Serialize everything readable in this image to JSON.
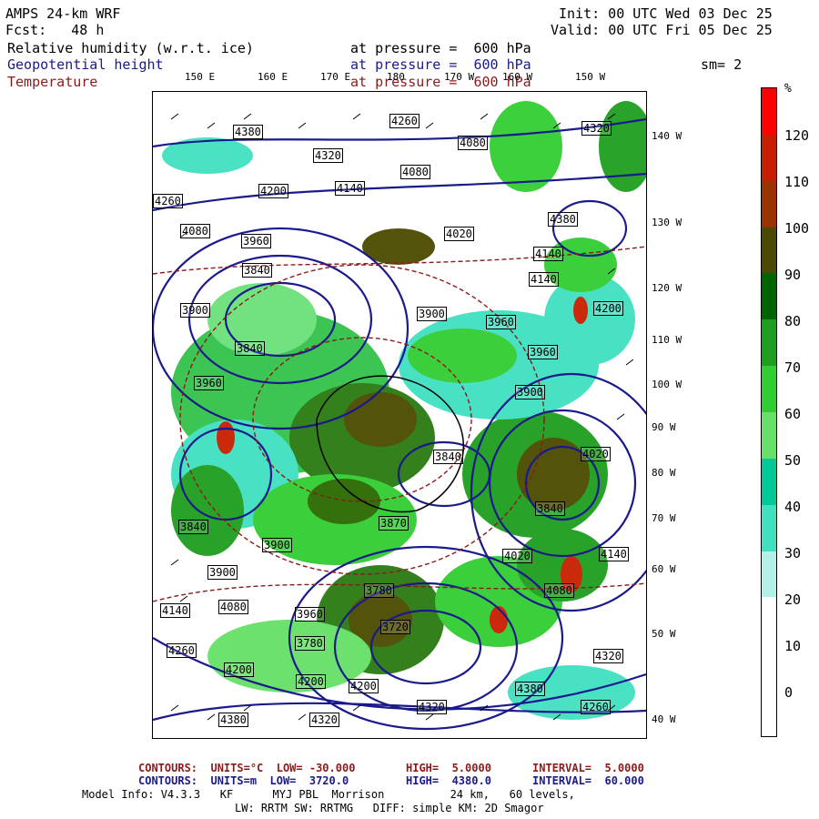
{
  "header": {
    "title": "AMPS 24-km WRF",
    "fcst": "Fcst:   48 h",
    "init": "Init: 00 UTC Wed 03 Dec 25",
    "valid": "Valid: 00 UTC Fri 05 Dec 25",
    "field1": "Relative humidity (w.r.t. ice)",
    "field2": "Geopotential height",
    "field3": "Temperature",
    "level1": "at pressure =  600 hPa",
    "level2": "at pressure =  600 hPa",
    "level3": "at pressure =  600 hPa",
    "sm": "sm= 2"
  },
  "colors": {
    "blue_text": "#1a1a8c",
    "maroon_text": "#8b1a1a",
    "height_contour": "#1a1a8c",
    "temp_contour": "#8b1a1a"
  },
  "longitude_labels": [
    "150 E",
    "160 E",
    "170 E",
    "180",
    "170 W",
    "160 W",
    "150 W"
  ],
  "latitude_labels": [
    "140 W",
    "130 W",
    "120 W",
    "110 W",
    "100 W",
    "90 W",
    "80 W",
    "70 W",
    "60 W",
    "50 W",
    "40 W"
  ],
  "height_labels": [
    "4380",
    "4320",
    "4200",
    "4140",
    "4260",
    "4080",
    "4080",
    "4380",
    "4320",
    "4140",
    "4020",
    "3960",
    "4260",
    "4080",
    "4140",
    "4200",
    "3840",
    "3900",
    "3900",
    "3960",
    "3840",
    "3900",
    "3960",
    "3960",
    "4020",
    "3840",
    "3900",
    "3870",
    "3840",
    "3840",
    "3900",
    "3960",
    "4020",
    "4080",
    "4140",
    "3780",
    "3720",
    "3780",
    "4080",
    "4140",
    "4200",
    "4320",
    "4380",
    "4320",
    "4260",
    "4200",
    "4200",
    "4320",
    "4260",
    "4380"
  ],
  "colorbar": {
    "unit": "%",
    "labels": [
      "120",
      "110",
      "100",
      "90",
      "80",
      "70",
      "60",
      "50",
      "40",
      "30",
      "20",
      "10",
      "0"
    ],
    "colors": [
      "#ff0000",
      "#c81e00",
      "#993300",
      "#4a4a00",
      "#006400",
      "#1e9e1e",
      "#32cd32",
      "#66e066",
      "#00c896",
      "#40e0c0",
      "#b4f0e6",
      "#ffffff",
      "#ffffff",
      "#ffffff"
    ]
  },
  "footer": {
    "line1_a": "CONTOURS:  UNITS=°C  LOW= -30.000",
    "line1_b": "HIGH=  5.0000",
    "line1_c": "INTERVAL=  5.0000",
    "line2_a": "CONTOURS:  UNITS=m  LOW=  3720.0",
    "line2_b": "HIGH=  4380.0",
    "line2_c": "INTERVAL=  60.000",
    "line3": "Model Info: V4.3.3   KF      MYJ PBL  Morrison          24 km,   60 levels,",
    "line4": "LW: RRTM SW: RRTMG   DIFF: simple KM: 2D Smagor"
  }
}
